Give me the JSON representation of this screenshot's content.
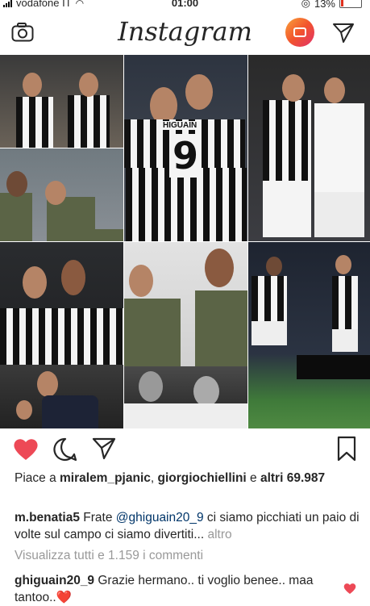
{
  "status_bar": {
    "carrier": "vodafone IT",
    "time": "01:00",
    "battery": "13%"
  },
  "header": {
    "logo": "Instagram",
    "camera_icon": "camera-icon",
    "tv_icon": "igtv-icon",
    "send_icon": "send-icon"
  },
  "post": {
    "likes_prefix": "Piace a ",
    "liker_1": "miralem_pjanic",
    "sep": ", ",
    "liker_2": "giorgiochiellini",
    "and": " e ",
    "others": "altri 69.987",
    "caption_user": "m.benatia5",
    "caption_pre": " Frate ",
    "caption_mention": "@ghiguain20_9",
    "caption_text": " ci siamo picchiati un paio di volte sul campo ci siamo divertiti...",
    "caption_more": " altro",
    "view_all": "Visualizza tutti e 1.159 i commenti",
    "comment_user": "ghiguain20_9",
    "comment_text": " Grazie hermano.. ti voglio benee.. maa tantoo..",
    "comment_emoji": "❤️",
    "photo_jersey_text": "HIGUAIN",
    "photo_number": "9"
  },
  "colors": {
    "like_red": "#ed4956",
    "text": "#262626",
    "muted": "#999999",
    "mention": "#003569"
  }
}
